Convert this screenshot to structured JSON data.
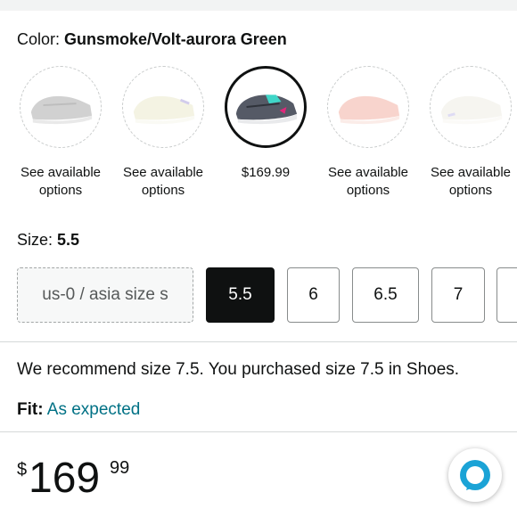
{
  "color": {
    "label": "Color:",
    "value": "Gunsmoke/Volt-aurora Green"
  },
  "swatches": [
    {
      "text_line1": "See available",
      "text_line2": "options",
      "icon": "shoe-gray-icon",
      "shoe_color": "#9a9a9a",
      "state": "unavailable"
    },
    {
      "text_line1": "See available",
      "text_line2": "options",
      "icon": "shoe-cream-icon",
      "shoe_color": "#e6e4c2",
      "state": "unavailable"
    },
    {
      "text_line1": "$169.99",
      "text_line2": "",
      "icon": "shoe-gunsmoke-icon",
      "shoe_color": "#555a66",
      "state": "selected"
    },
    {
      "text_line1": "See available",
      "text_line2": "options",
      "icon": "shoe-peach-icon",
      "shoe_color": "#f0a190",
      "state": "unavailable"
    },
    {
      "text_line1": "See available",
      "text_line2": "options",
      "icon": "shoe-white-icon",
      "shoe_color": "#ece8de",
      "state": "unavailable"
    }
  ],
  "size": {
    "label": "Size:",
    "value": "5.5",
    "options": [
      "us-0 / asia size s",
      "5.5",
      "6",
      "6.5",
      "7"
    ]
  },
  "recommendation": "We recommend size 7.5. You purchased size 7.5 in Shoes.",
  "fit": {
    "label": "Fit:",
    "value": "As expected"
  },
  "price": {
    "symbol": "$",
    "whole": "169",
    "fraction": "99"
  },
  "colors": {
    "link": "#007185",
    "alexa": "#1ba3d6"
  }
}
